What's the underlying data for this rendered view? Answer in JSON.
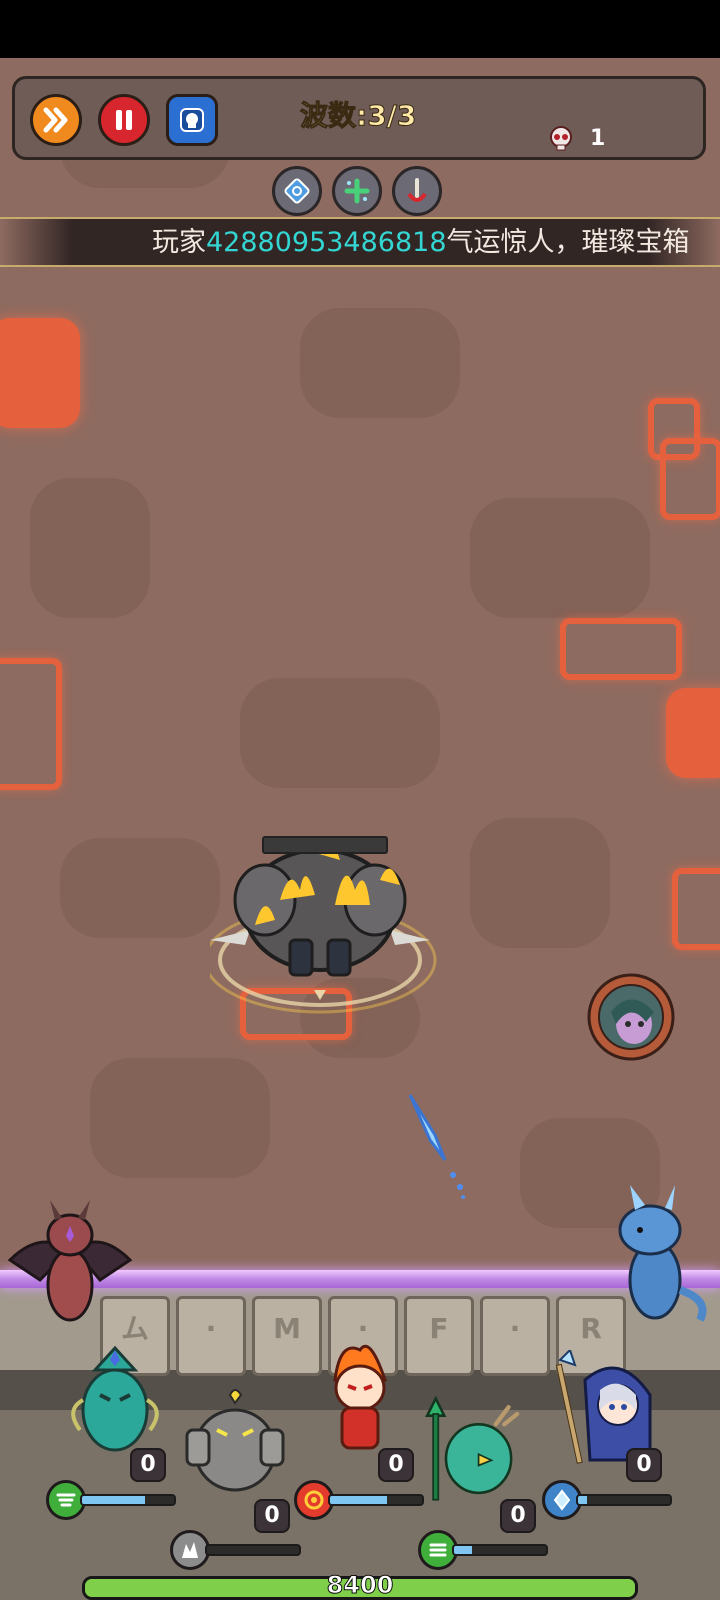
{
  "hud": {
    "speed_button_icon": "double-chevron-icon",
    "pause_button_icon": "pause-icon",
    "card_button_icon": "skull-card-icon",
    "wave_label": "波数:3/3",
    "kill_count": "1"
  },
  "skills": [
    {
      "icon": "clock-shield-icon"
    },
    {
      "icon": "sparkle-plus-icon"
    },
    {
      "icon": "sword-magnet-icon"
    }
  ],
  "banner": {
    "prefix": "玩家",
    "player_id": "42880953486818",
    "suffix": "气运惊人，璀璨宝箱"
  },
  "battlefield": {
    "boss_hp": 0.0
  },
  "heroes": [
    {
      "name": "wind-spirit",
      "level": "0",
      "element": "wind-icon",
      "element_color": "#3fae3a",
      "mana": 0.68
    },
    {
      "name": "rock-golem",
      "level": "0",
      "element": "rock-icon",
      "element_color": "#8c8c8c",
      "mana": 0.0
    },
    {
      "name": "fire-hero",
      "level": "0",
      "element": "fire-icon",
      "element_color": "#e33b2c",
      "mana": 0.62
    },
    {
      "name": "nature-bird",
      "level": "0",
      "element": "leaf-icon",
      "element_color": "#3fae3a",
      "mana": 0.2
    },
    {
      "name": "ice-mage",
      "level": "0",
      "element": "ice-crystal-icon",
      "element_color": "#3f83c9",
      "mana": 0.1
    }
  ],
  "base": {
    "hp_text": "8400",
    "hp_fraction": 1.0
  },
  "colors": {
    "ground": "#8e6b60",
    "lava": "#e5603d",
    "banner_highlight": "#33d6d2",
    "mana": "#7fc6f3",
    "base_hp": "#7fcf4a"
  }
}
